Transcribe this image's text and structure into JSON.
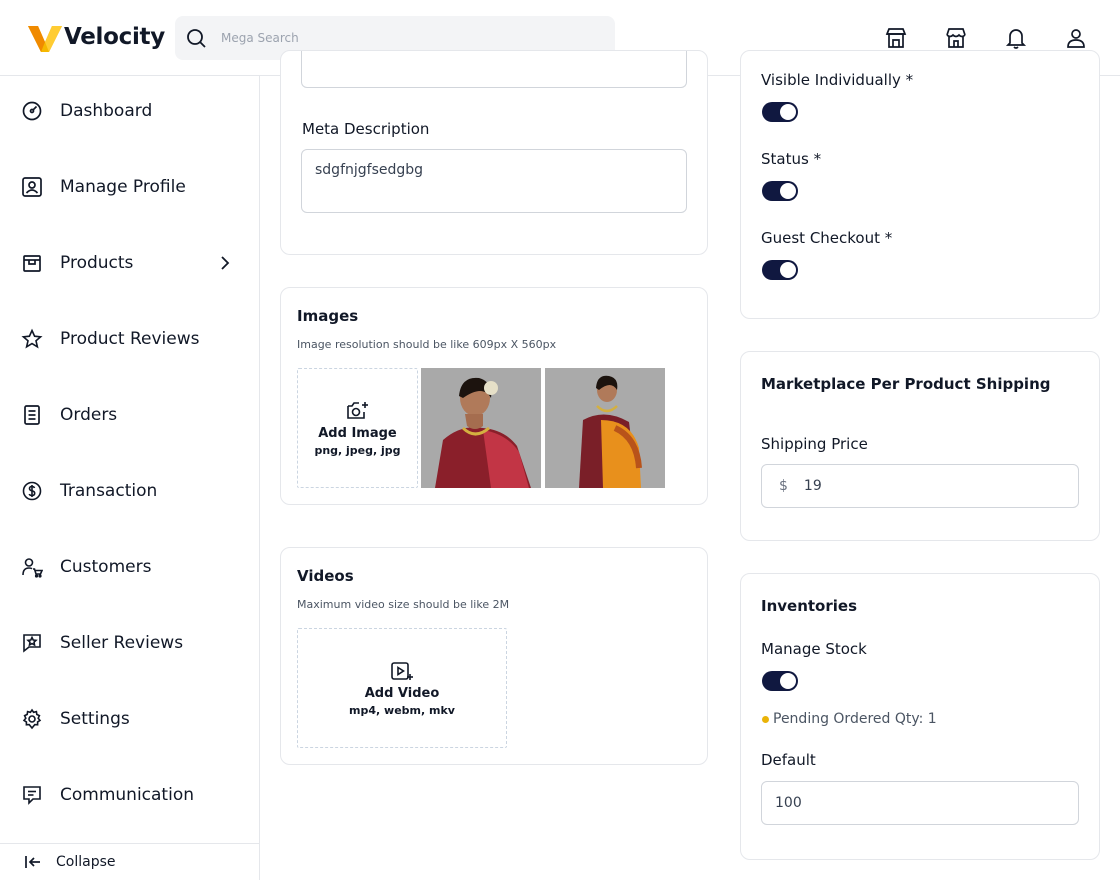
{
  "app": {
    "name": "Velocity"
  },
  "search": {
    "placeholder": "Mega Search"
  },
  "header_icons": [
    "store-icon",
    "shop-icon",
    "bell-icon",
    "user-icon"
  ],
  "sidebar": {
    "items": [
      {
        "label": "Dashboard",
        "icon": "dashboard-icon"
      },
      {
        "label": "Manage Profile",
        "icon": "profile-icon"
      },
      {
        "label": "Products",
        "icon": "products-icon",
        "has_submenu": true
      },
      {
        "label": "Product Reviews",
        "icon": "star-icon"
      },
      {
        "label": "Orders",
        "icon": "orders-icon"
      },
      {
        "label": "Transaction",
        "icon": "dollar-icon"
      },
      {
        "label": "Customers",
        "icon": "customers-icon"
      },
      {
        "label": "Seller Reviews",
        "icon": "seller-review-icon"
      },
      {
        "label": "Settings",
        "icon": "gear-icon"
      },
      {
        "label": "Communication",
        "icon": "chat-icon"
      }
    ],
    "collapse_label": "Collapse"
  },
  "seo": {
    "meta_description_label": "Meta Description",
    "meta_description_value": "sdgfnjgfsedgbg"
  },
  "images": {
    "title": "Images",
    "hint": "Image resolution should be like 609px X 560px",
    "add_label": "Add Image",
    "formats": "png, jpeg, jpg"
  },
  "videos": {
    "title": "Videos",
    "hint": "Maximum video size should be like 2M",
    "add_label": "Add Video",
    "formats": "mp4, webm, mkv"
  },
  "visibility": {
    "visible_individually_label": "Visible Individually  *",
    "status_label": "Status  *",
    "guest_checkout_label": "Guest Checkout  *",
    "visible_individually_on": true,
    "status_on": true,
    "guest_checkout_on": true
  },
  "shipping": {
    "title": "Marketplace Per Product Shipping",
    "price_label": "Shipping Price",
    "currency": "$",
    "price_value": "19"
  },
  "inventories": {
    "title": "Inventories",
    "manage_stock_label": "Manage Stock",
    "manage_stock_on": true,
    "pending_text": "Pending Ordered Qty: 1",
    "default_label": "Default",
    "default_value": "100"
  },
  "colors": {
    "accent": "#101840",
    "logo_yellow": "#f5b800",
    "logo_orange": "#f08a00",
    "pending_dot": "#eab308"
  }
}
